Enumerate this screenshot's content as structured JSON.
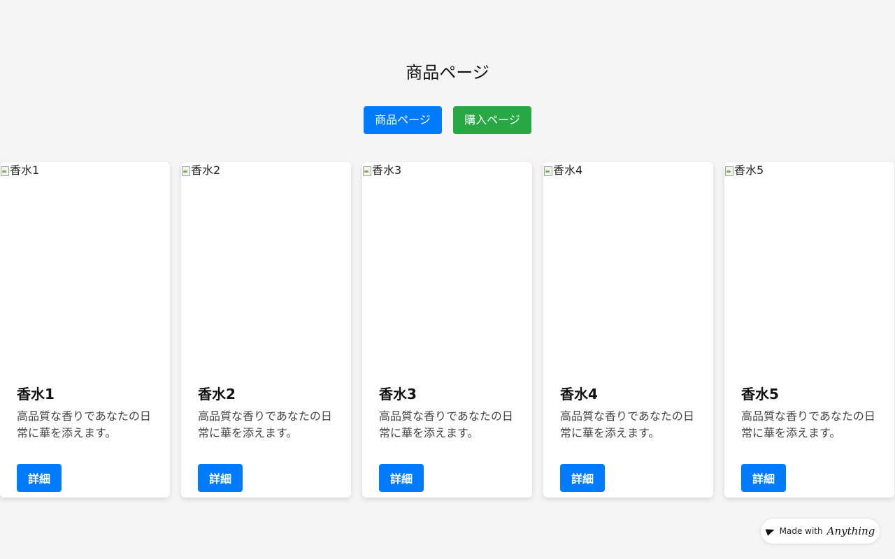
{
  "header": {
    "title": "商品ページ"
  },
  "nav": {
    "products_label": "商品ページ",
    "purchase_label": "購入ページ"
  },
  "products": [
    {
      "image_alt": "香水1",
      "name": "香水1",
      "description": "高品質な香りであなたの日常に華を添えます。",
      "button_label": "詳細"
    },
    {
      "image_alt": "香水2",
      "name": "香水2",
      "description": "高品質な香りであなたの日常に華を添えます。",
      "button_label": "詳細"
    },
    {
      "image_alt": "香水3",
      "name": "香水3",
      "description": "高品質な香りであなたの日常に華を添えます。",
      "button_label": "詳細"
    },
    {
      "image_alt": "香水4",
      "name": "香水4",
      "description": "高品質な香りであなたの日常に華を添えます。",
      "button_label": "詳細"
    },
    {
      "image_alt": "香水5",
      "name": "香水5",
      "description": "高品質な香りであなたの日常に華を添えます。",
      "button_label": "詳細"
    }
  ],
  "badge": {
    "prefix": "Made with",
    "brand": "Anything"
  },
  "colors": {
    "primary": "#007bff",
    "success": "#28a745",
    "background": "#f5f5f5"
  }
}
